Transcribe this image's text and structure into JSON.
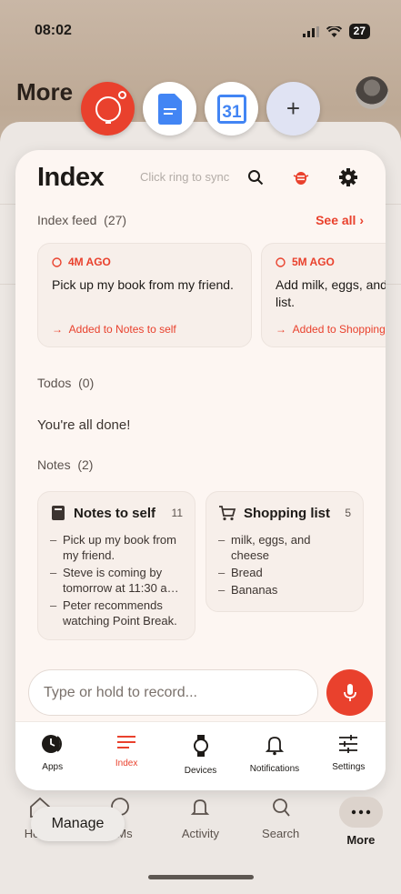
{
  "status_bar": {
    "time": "08:02",
    "battery": "27"
  },
  "background": {
    "title": "More",
    "nav": [
      {
        "label": "Home",
        "icon": "home-icon"
      },
      {
        "label": "DMs",
        "icon": "chat-icon"
      },
      {
        "label": "Activity",
        "icon": "bell-icon"
      },
      {
        "label": "Search",
        "icon": "search-icon"
      },
      {
        "label": "More",
        "icon": "more-icon"
      }
    ],
    "manage_label": "Manage"
  },
  "shortcuts": [
    {
      "name": "index-ring",
      "icon": "ring-icon"
    },
    {
      "name": "google-docs",
      "icon": "docs-icon"
    },
    {
      "name": "google-calendar",
      "icon": "calendar-icon",
      "label": "31"
    },
    {
      "name": "add",
      "icon": "plus-icon",
      "label": "+"
    }
  ],
  "panel": {
    "title": "Index",
    "sync_hint": "Click ring to sync",
    "feed": {
      "label": "Index feed",
      "count": "(27)",
      "see_all": "See all ›",
      "cards": [
        {
          "time": "4M AGO",
          "text": "Pick up my book from my friend.",
          "added": "Added to Notes to self"
        },
        {
          "time": "5M AGO",
          "text": "Add milk, eggs, and shopping list.",
          "added": "Added to Shopping list"
        }
      ]
    },
    "todos": {
      "label": "Todos",
      "count": "(0)",
      "empty": "You're all done!"
    },
    "notes": {
      "label": "Notes",
      "count": "(2)",
      "cards": [
        {
          "title": "Notes to self",
          "icon": "notebook-icon",
          "count": "11",
          "items": [
            "Pick up my book from my friend.",
            "Steve is coming by tomorrow at 11:30 a…",
            "Peter recommends watching Point Break."
          ]
        },
        {
          "title": "Shopping list",
          "icon": "cart-icon",
          "count": "5",
          "items": [
            "milk, eggs, and cheese",
            "Bread",
            "Bananas"
          ]
        }
      ]
    },
    "input_placeholder": "Type or hold to record...",
    "nav": [
      {
        "label": "Apps",
        "icon": "apps-icon"
      },
      {
        "label": "Index",
        "icon": "index-icon",
        "active": true
      },
      {
        "label": "Devices",
        "icon": "watch-icon"
      },
      {
        "label": "Notifications",
        "icon": "bell-icon"
      },
      {
        "label": "Settings",
        "icon": "sliders-icon"
      }
    ]
  },
  "colors": {
    "accent": "#e9412d",
    "panel_bg": "#fdf6f2",
    "card_bg": "#f7efea"
  }
}
